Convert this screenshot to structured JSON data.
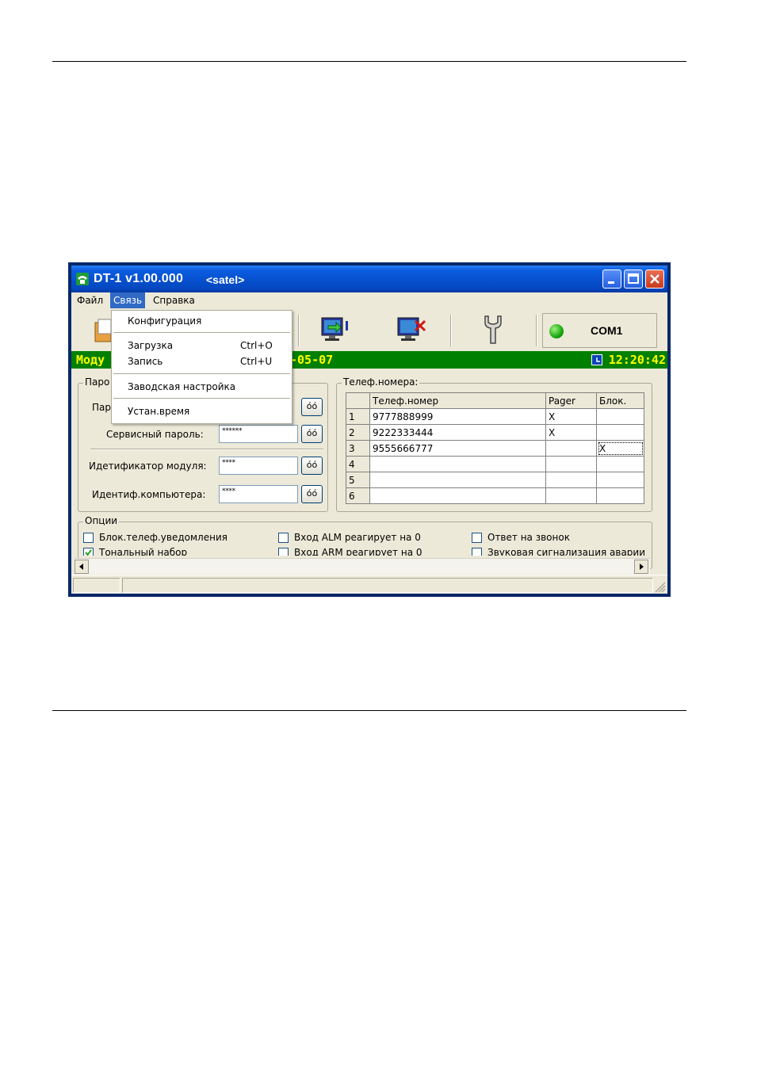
{
  "window": {
    "title": "DT-1 v1.00.000",
    "user": "<satel>"
  },
  "menu": {
    "file": "Файл",
    "connection": "Связь",
    "help": "Справка"
  },
  "dropdown": {
    "items": [
      {
        "label": "Конфигурация",
        "shortcut": ""
      },
      {
        "label": "Загрузка",
        "shortcut": "Ctrl+O"
      },
      {
        "label": "Запись",
        "shortcut": "Ctrl+U"
      },
      {
        "label": "Заводская настройка",
        "shortcut": ""
      },
      {
        "label": "Устан.время",
        "shortcut": ""
      }
    ]
  },
  "toolbar": {
    "com_port": "COM1",
    "icons": [
      "open-file-icon",
      "upload-to-monitor-icon",
      "disconnect-monitor-icon",
      "wrench-icon",
      "connection-led-icon"
    ]
  },
  "status_green": {
    "left": "Моду",
    "date": "-05-07",
    "time": "12:20:42",
    "text_color": "#ffff00",
    "bg_color": "#008000"
  },
  "passwords": {
    "group_label": "Паро",
    "password_label": "Пар",
    "service_label": "Сервисный пароль:",
    "service_value": "******",
    "module_id_label": "Идетификатор модуля:",
    "module_id_value": "****",
    "computer_id_label": "Идентиф.компьютера:",
    "computer_id_value": "****",
    "show_button": "όό"
  },
  "phones": {
    "group_label": "Телеф.номера:",
    "headers": [
      "Телеф.номер",
      "Pager",
      "Блок."
    ],
    "rows": [
      {
        "idx": "1",
        "number": "9777888999",
        "pager": "X",
        "block": ""
      },
      {
        "idx": "2",
        "number": "9222333444",
        "pager": "X",
        "block": ""
      },
      {
        "idx": "3",
        "number": "9555666777",
        "pager": "",
        "block": "X"
      },
      {
        "idx": "4",
        "number": "",
        "pager": "",
        "block": ""
      },
      {
        "idx": "5",
        "number": "",
        "pager": "",
        "block": ""
      },
      {
        "idx": "6",
        "number": "",
        "pager": "",
        "block": ""
      }
    ]
  },
  "options": {
    "group_label": "Опции",
    "items": [
      {
        "label": "Блок.телеф.уведомления",
        "checked": false
      },
      {
        "label": "Вход ALM реагирует на 0",
        "checked": false
      },
      {
        "label": "Ответ на звонок",
        "checked": false
      },
      {
        "label": "Тональный набор",
        "checked": true
      },
      {
        "label": "Вход ARM реагирует на 0",
        "checked": false
      },
      {
        "label": "Звуковая сигнализация аварии",
        "checked": false
      }
    ]
  }
}
